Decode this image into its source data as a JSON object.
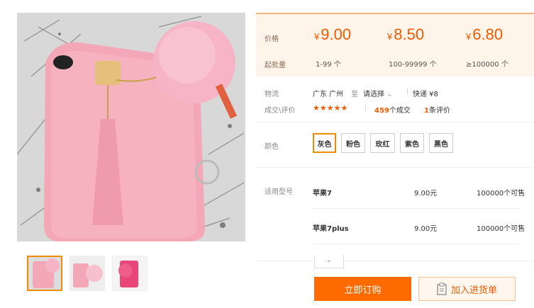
{
  "product": {
    "image_alt": "粉色兔毛手机壳 带毛球流苏挂饰",
    "thumbnails": [
      "粉色手机壳",
      "粉色手机壳-毛球",
      "玫红手机壳"
    ]
  },
  "pricing": {
    "price_label": "价格",
    "moq_label": "起批量",
    "tiers": [
      {
        "currency": "¥",
        "price": "9.00",
        "qty": "1-99 个"
      },
      {
        "currency": "¥",
        "price": "8.50",
        "qty": "100-99999 个"
      },
      {
        "currency": "¥",
        "price": "6.80",
        "qty": "≥100000 个"
      }
    ]
  },
  "logistics": {
    "label": "物流",
    "from": "广东 广州",
    "to_word": "至",
    "to": "请选择",
    "separator": "|",
    "shipping": "快递 ¥8"
  },
  "deals": {
    "label": "成交\\评价",
    "stars": "★★★★★",
    "count": "459",
    "count_suffix": "个成交",
    "reviews": "1",
    "reviews_suffix": "条评价"
  },
  "colors": {
    "label": "颜色",
    "options": [
      "灰色",
      "粉色",
      "玫红",
      "紫色",
      "黑色"
    ],
    "selected": 0
  },
  "models": {
    "label": "适用型号",
    "rows": [
      {
        "name": "苹果7",
        "price": "9.00元",
        "avail": "100000个可售"
      },
      {
        "name": "苹果7plus",
        "price": "9.00元",
        "avail": "100000个可售"
      }
    ]
  },
  "actions": {
    "order": "立即订购",
    "cart": "加入进货单"
  },
  "colors_theme": {
    "accent": "#ff6a00",
    "price": "#f05a00",
    "panel_bg": "#fff4ea"
  }
}
